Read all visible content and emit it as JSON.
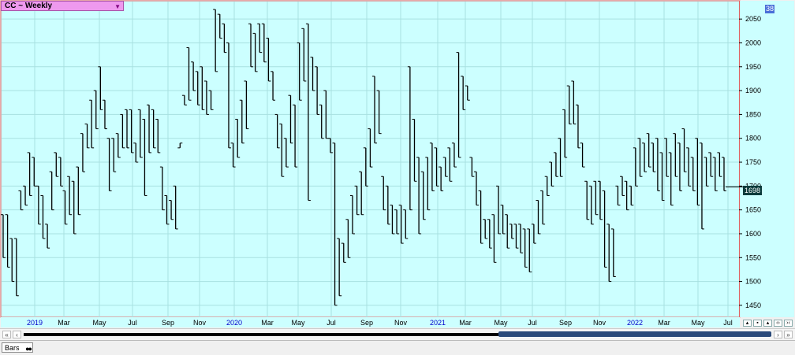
{
  "header": {
    "title": "CC ~ Weekly",
    "dropdown_icon": "dropdown-arrow-icon",
    "badge": "38"
  },
  "price_tag": "1698",
  "toolbar": {
    "tab_label": "Bars",
    "tab_icon": "binoculars-icon"
  },
  "scroll": {
    "left_icon": "double-left-arrow",
    "right_icon": "double-right-arrow"
  },
  "colors": {
    "plot_bg": "#ccffff",
    "bar": "#000000",
    "grid": "#99dddd",
    "border_red": "#e06060",
    "price_tag_bg": "#0a3b3b"
  },
  "chart_data": {
    "type": "ohlc",
    "title": "CC ~ Weekly",
    "ylim": [
      1430,
      2080
    ],
    "yticks": [
      1450,
      1500,
      1550,
      1600,
      1650,
      1700,
      1750,
      1800,
      1850,
      1900,
      1950,
      2000,
      2050
    ],
    "xticks": [
      "2019",
      "Mar",
      "May",
      "Jul",
      "Sep",
      "Nov",
      "2020",
      "Mar",
      "May",
      "Jul",
      "Sep",
      "Nov",
      "2021",
      "Mar",
      "May",
      "Jul",
      "Sep",
      "Nov",
      "2022",
      "Mar",
      "May",
      "Jul"
    ],
    "last_price": 1698,
    "grid": true,
    "bars": [
      [
        1640,
        1550
      ],
      [
        1640,
        1530
      ],
      [
        1590,
        1500
      ],
      [
        1590,
        1470
      ],
      [
        1690,
        1650
      ],
      [
        1700,
        1660
      ],
      [
        1770,
        1680
      ],
      [
        1760,
        1700
      ],
      [
        1700,
        1620
      ],
      [
        1680,
        1590
      ],
      [
        1620,
        1570
      ],
      [
        1730,
        1650
      ],
      [
        1770,
        1720
      ],
      [
        1760,
        1700
      ],
      [
        1690,
        1620
      ],
      [
        1720,
        1640
      ],
      [
        1710,
        1600
      ],
      [
        1740,
        1640
      ],
      [
        1810,
        1730
      ],
      [
        1830,
        1780
      ],
      [
        1880,
        1780
      ],
      [
        1900,
        1820
      ],
      [
        1950,
        1860
      ],
      [
        1880,
        1820
      ],
      [
        1800,
        1690
      ],
      [
        1800,
        1730
      ],
      [
        1810,
        1760
      ],
      [
        1850,
        1780
      ],
      [
        1860,
        1780
      ],
      [
        1860,
        1770
      ],
      [
        1790,
        1750
      ],
      [
        1860,
        1760
      ],
      [
        1840,
        1680
      ],
      [
        1870,
        1770
      ],
      [
        1860,
        1780
      ],
      [
        1840,
        1770
      ],
      [
        1740,
        1650
      ],
      [
        1680,
        1620
      ],
      [
        1670,
        1630
      ],
      [
        1700,
        1610
      ],
      [
        1780,
        1790
      ],
      [
        1890,
        1870
      ],
      [
        1990,
        1880
      ],
      [
        1960,
        1900
      ],
      [
        1940,
        1870
      ],
      [
        1950,
        1860
      ],
      [
        1920,
        1850
      ],
      [
        1900,
        1860
      ],
      [
        2070,
        1940
      ],
      [
        2060,
        2010
      ],
      [
        2040,
        1980
      ],
      [
        2000,
        1780
      ],
      [
        1790,
        1740
      ],
      [
        1840,
        1760
      ],
      [
        1880,
        1790
      ],
      [
        1920,
        1820
      ],
      [
        2040,
        1950
      ],
      [
        2020,
        1940
      ],
      [
        2040,
        1980
      ],
      [
        2040,
        1960
      ],
      [
        2010,
        1920
      ],
      [
        1940,
        1880
      ],
      [
        1850,
        1780
      ],
      [
        1830,
        1720
      ],
      [
        1800,
        1740
      ],
      [
        1890,
        1790
      ],
      [
        1870,
        1740
      ],
      [
        2000,
        1880
      ],
      [
        2030,
        1920
      ],
      [
        2040,
        1670
      ],
      [
        1970,
        1900
      ],
      [
        1950,
        1850
      ],
      [
        1870,
        1800
      ],
      [
        1900,
        1800
      ],
      [
        1800,
        1770
      ],
      [
        1790,
        1450
      ],
      [
        1590,
        1470
      ],
      [
        1580,
        1540
      ],
      [
        1630,
        1550
      ],
      [
        1680,
        1600
      ],
      [
        1700,
        1640
      ],
      [
        1730,
        1640
      ],
      [
        1780,
        1700
      ],
      [
        1820,
        1740
      ],
      [
        1930,
        1790
      ],
      [
        1900,
        1810
      ],
      [
        1720,
        1650
      ],
      [
        1700,
        1620
      ],
      [
        1660,
        1600
      ],
      [
        1650,
        1600
      ],
      [
        1660,
        1580
      ],
      [
        1650,
        1590
      ],
      [
        1950,
        1650
      ],
      [
        1840,
        1710
      ],
      [
        1760,
        1600
      ],
      [
        1730,
        1630
      ],
      [
        1760,
        1650
      ],
      [
        1790,
        1690
      ],
      [
        1780,
        1700
      ],
      [
        1740,
        1690
      ],
      [
        1760,
        1720
      ],
      [
        1780,
        1710
      ],
      [
        1790,
        1740
      ],
      [
        1980,
        1760
      ],
      [
        1930,
        1860
      ],
      [
        1910,
        1880
      ],
      [
        1760,
        1720
      ],
      [
        1730,
        1660
      ],
      [
        1690,
        1580
      ],
      [
        1630,
        1590
      ],
      [
        1630,
        1570
      ],
      [
        1640,
        1540
      ],
      [
        1700,
        1600
      ],
      [
        1660,
        1600
      ],
      [
        1640,
        1570
      ],
      [
        1620,
        1590
      ],
      [
        1620,
        1570
      ],
      [
        1620,
        1560
      ],
      [
        1610,
        1530
      ],
      [
        1610,
        1520
      ],
      [
        1620,
        1580
      ],
      [
        1670,
        1600
      ],
      [
        1690,
        1620
      ],
      [
        1720,
        1680
      ],
      [
        1750,
        1700
      ],
      [
        1770,
        1720
      ],
      [
        1800,
        1720
      ],
      [
        1860,
        1760
      ],
      [
        1910,
        1830
      ],
      [
        1920,
        1830
      ],
      [
        1870,
        1780
      ],
      [
        1790,
        1740
      ],
      [
        1710,
        1630
      ],
      [
        1700,
        1620
      ],
      [
        1710,
        1640
      ],
      [
        1710,
        1630
      ],
      [
        1690,
        1530
      ],
      [
        1620,
        1500
      ],
      [
        1610,
        1510
      ],
      [
        1700,
        1660
      ],
      [
        1720,
        1680
      ],
      [
        1710,
        1650
      ],
      [
        1700,
        1660
      ],
      [
        1780,
        1700
      ],
      [
        1800,
        1720
      ],
      [
        1790,
        1730
      ],
      [
        1810,
        1740
      ],
      [
        1790,
        1730
      ],
      [
        1800,
        1690
      ],
      [
        1770,
        1670
      ],
      [
        1800,
        1720
      ],
      [
        1770,
        1660
      ],
      [
        1810,
        1720
      ],
      [
        1790,
        1690
      ],
      [
        1820,
        1730
      ],
      [
        1780,
        1700
      ],
      [
        1760,
        1690
      ],
      [
        1800,
        1660
      ],
      [
        1790,
        1610
      ],
      [
        1760,
        1700
      ],
      [
        1770,
        1720
      ],
      [
        1760,
        1690
      ],
      [
        1770,
        1720
      ],
      [
        1760,
        1690
      ]
    ]
  }
}
